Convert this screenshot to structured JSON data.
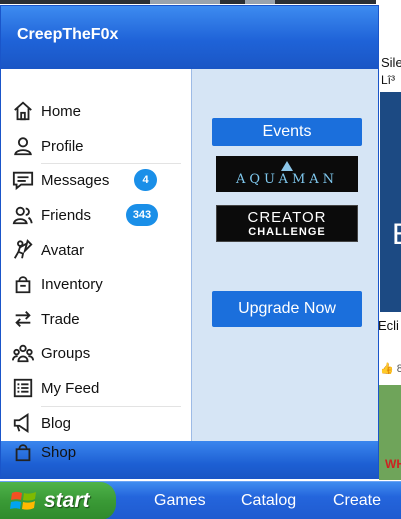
{
  "menu": {
    "username": "CreepTheF0x",
    "nav_items": [
      {
        "label": "Home",
        "icon": "home-icon"
      },
      {
        "label": "Profile",
        "icon": "profile-icon"
      },
      {
        "label": "Messages",
        "icon": "messages-icon",
        "badge": "4"
      },
      {
        "label": "Friends",
        "icon": "friends-icon",
        "badge": "343"
      },
      {
        "label": "Avatar",
        "icon": "avatar-icon"
      },
      {
        "label": "Inventory",
        "icon": "inventory-icon"
      },
      {
        "label": "Trade",
        "icon": "trade-icon"
      },
      {
        "label": "Groups",
        "icon": "groups-icon"
      },
      {
        "label": "My Feed",
        "icon": "feed-icon"
      },
      {
        "label": "Blog",
        "icon": "blog-icon"
      },
      {
        "label": "Shop",
        "icon": "shop-icon"
      }
    ],
    "events_label": "Events",
    "promos": [
      {
        "text": "AQUAMAN"
      },
      {
        "line1": "CREATOR",
        "line2": "CHALLENGE"
      }
    ],
    "upgrade_label": "Upgrade Now"
  },
  "taskbar": {
    "start_label": "start",
    "links": [
      "Games",
      "Catalog",
      "Create"
    ]
  },
  "background": {
    "snippet1": "Sile",
    "snippet2": "Lî³",
    "snippet3": "Ecli",
    "snippet4": "8",
    "thumb_letter": "E",
    "thumb2_text": "WH"
  },
  "colors": {
    "accent_blue": "#1b6fdc",
    "badge_blue": "#1a8fe8",
    "start_green": "#3a9a36",
    "panel_light_blue": "#d6e5f5"
  }
}
